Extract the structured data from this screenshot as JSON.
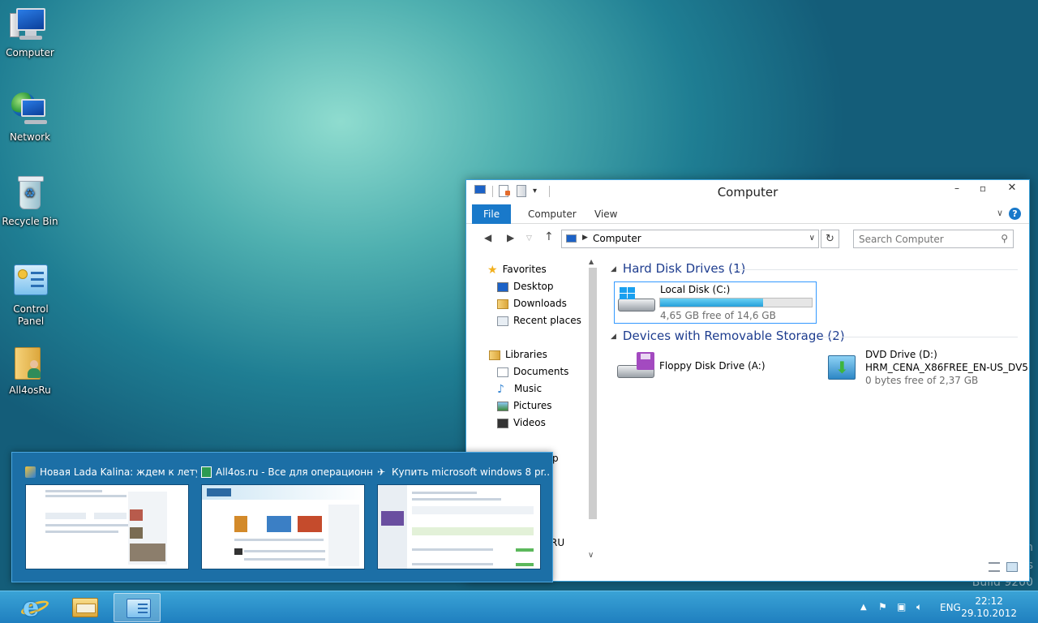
{
  "desktop": {
    "icons": [
      {
        "label": "Computer"
      },
      {
        "label": "Network"
      },
      {
        "label": "Recycle Bin"
      },
      {
        "label": "Control Panel"
      },
      {
        "label": "All4osRu"
      }
    ],
    "watermark": {
      "line1": "n",
      "line2": "s",
      "line3": "Build 9200"
    }
  },
  "explorer": {
    "title": "Computer",
    "ribbon": {
      "tabs": [
        "File",
        "Computer",
        "View"
      ],
      "help": "?"
    },
    "address": {
      "path": "Computer"
    },
    "search": {
      "placeholder": "Search Computer"
    },
    "nav_pane": {
      "favorites": "Favorites",
      "favorites_items": [
        "Desktop",
        "Downloads",
        "Recent places"
      ],
      "libraries": "Libraries",
      "libraries_items": [
        "Documents",
        "Music",
        "Pictures",
        "Videos"
      ],
      "partial_items": [
        "p",
        "RU"
      ]
    },
    "groups": [
      {
        "heading": "Hard Disk Drives (1)"
      },
      {
        "heading": "Devices with Removable Storage (2)"
      }
    ],
    "drives": {
      "local_c": {
        "name": "Local Disk (C:)",
        "free": "4,65 GB free of 14,6 GB",
        "used_fraction": 0.68
      },
      "floppy_a": {
        "name": "Floppy Disk Drive (A:)"
      },
      "dvd_d": {
        "name": "DVD Drive (D:)",
        "label": "HRM_CENA_X86FREE_EN-US_DV5",
        "free": "0 bytes free of 2,37 GB"
      }
    }
  },
  "thumbnails": [
    {
      "title": "Новая Lada Kalina: ждем к лету..."
    },
    {
      "title": "All4os.ru - Все для операционн..."
    },
    {
      "title": "Купить microsoft windows 8 pr..."
    }
  ],
  "taskbar": {
    "tray": {
      "language": "ENG"
    },
    "clock": {
      "time": "22:12",
      "date": "29.10.2012"
    }
  }
}
